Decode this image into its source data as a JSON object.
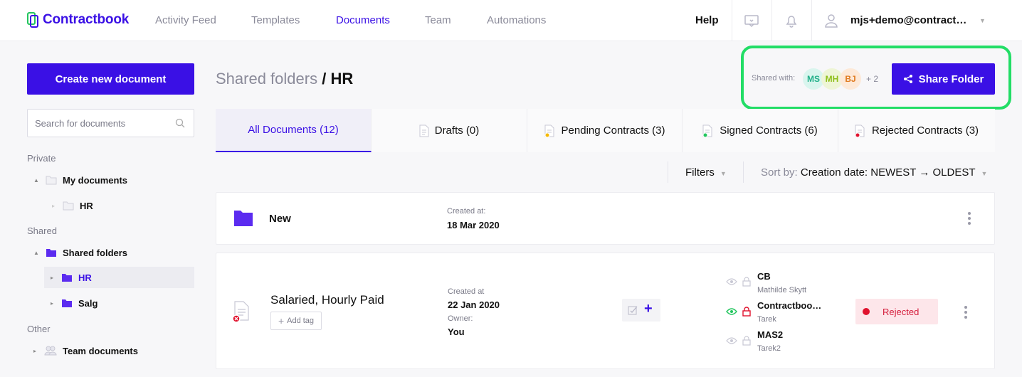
{
  "brand": {
    "name": "Contractbook",
    "color": "#3a10e5"
  },
  "nav": {
    "items": [
      {
        "label": "Activity Feed"
      },
      {
        "label": "Templates"
      },
      {
        "label": "Documents"
      },
      {
        "label": "Team"
      },
      {
        "label": "Automations"
      }
    ],
    "active": "Documents",
    "help": "Help",
    "user": "mjs+demo@contractbook.dk"
  },
  "sidebar": {
    "create_button": "Create new document",
    "search_placeholder": "Search for documents",
    "sections": [
      {
        "heading": "Private"
      },
      {
        "heading": "Shared"
      },
      {
        "heading": "Other"
      }
    ],
    "tree": [
      {
        "label": "My documents"
      },
      {
        "label": "HR"
      },
      {
        "label": "Shared folders"
      },
      {
        "label": "HR"
      },
      {
        "label": "Salg"
      },
      {
        "label": "Team documents"
      }
    ]
  },
  "header": {
    "breadcrumb_parent": "Shared folders",
    "breadcrumb_sep": "/",
    "breadcrumb_current": "HR",
    "shared_with_label": "Shared with:",
    "avatars": [
      {
        "initials": "MS",
        "bg": "#d9f5ee",
        "fg": "#22b08a"
      },
      {
        "initials": "MH",
        "bg": "#eef5d6",
        "fg": "#8fbf1a"
      },
      {
        "initials": "BJ",
        "bg": "#fde9d8",
        "fg": "#e07a1f"
      }
    ],
    "more_count": "+ 2",
    "share_button": "Share Folder"
  },
  "tabs": [
    {
      "label": "All Documents (12)"
    },
    {
      "label": "Drafts (0)"
    },
    {
      "label": "Pending Contracts (3)"
    },
    {
      "label": "Signed Contracts (6)"
    },
    {
      "label": "Rejected Contracts (3)"
    }
  ],
  "toolbar": {
    "filters": "Filters",
    "sort_label": "Sort by:",
    "sort_value": "Creation date: NEWEST → OLDEST"
  },
  "folder_row": {
    "name": "New",
    "created_label": "Created at:",
    "created_value": "18 Mar 2020"
  },
  "doc_row": {
    "title": "Salaried, Hourly Paid",
    "add_tag": "Add tag",
    "created_label": "Created at",
    "created_value": "22 Jan 2020",
    "owner_label": "Owner:",
    "owner_value": "You",
    "signers": [
      {
        "name": "CB",
        "sub": "Mathilde Skytt"
      },
      {
        "name": "Contractboo…",
        "sub": "Tarek"
      },
      {
        "name": "MAS2",
        "sub": "Tarek2"
      }
    ],
    "status": "Rejected"
  }
}
